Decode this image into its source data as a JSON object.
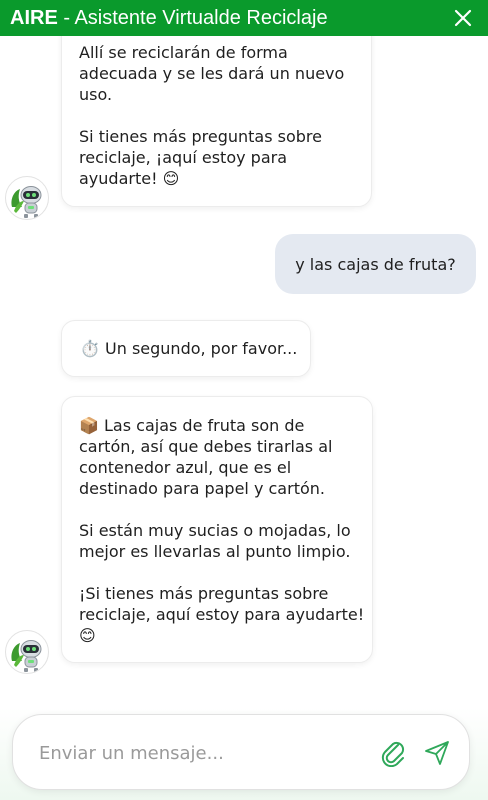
{
  "header": {
    "brand": "AIRE",
    "title": " - Asistente Virtualde Reciclaje",
    "close_icon": "close-icon"
  },
  "messages": [
    {
      "sender": "bot",
      "paragraphs": [
        [
          "Allí se reciclarán de forma",
          "adecuada y se les dará un nuevo",
          "uso."
        ],
        [
          "Si tienes más preguntas sobre",
          "reciclaje, ¡aquí estoy para",
          "ayudarte! 😊"
        ]
      ]
    },
    {
      "sender": "user",
      "text": "y las cajas de fruta?"
    },
    {
      "sender": "bot",
      "text": "⏱️ Un segundo, por favor..."
    },
    {
      "sender": "bot",
      "paragraphs": [
        [
          "📦 Las cajas de fruta son de",
          "cartón, así que debes tirarlas al",
          "contenedor azul, que es el",
          "destinado para papel y cartón."
        ],
        [
          "Si están muy sucias o mojadas, lo",
          "mejor es llevarlas al punto limpio."
        ],
        [
          "¡Si tienes más preguntas sobre",
          "reciclaje, aquí estoy para ayudarte!",
          "😊"
        ]
      ]
    }
  ],
  "avatar_icon": "robot-avatar-icon",
  "composer": {
    "placeholder": "Enviar un mensaje...",
    "attach_icon": "paperclip-icon",
    "send_icon": "send-icon"
  },
  "colors": {
    "brand_green": "#0a9a2c",
    "user_bubble": "#e4e9f1",
    "icon_green": "#2fa85a"
  }
}
